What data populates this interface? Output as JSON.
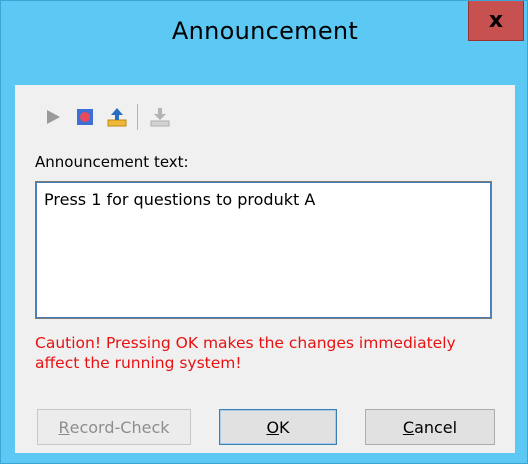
{
  "window": {
    "title": "Announcement",
    "close_glyph": "x"
  },
  "toolbar": {
    "buttons": [
      {
        "icon": "play-icon",
        "enabled": false
      },
      {
        "icon": "record-icon",
        "enabled": true
      },
      {
        "icon": "upload-icon",
        "enabled": true
      },
      {
        "icon": "download-icon",
        "enabled": false
      }
    ]
  },
  "form": {
    "label": "Announcement text:",
    "text_value": "Press 1 for questions to produkt A",
    "caution": "Caution! Pressing OK makes the changes immediately affect the running system!"
  },
  "buttons": {
    "record_check": {
      "mnemonic": "R",
      "rest": "ecord-Check",
      "enabled": false
    },
    "ok": {
      "mnemonic": "O",
      "rest": "K"
    },
    "cancel": {
      "mnemonic": "C",
      "rest": "ancel"
    }
  },
  "colors": {
    "titlebar": "#5cc9f5",
    "close_button": "#c75050",
    "caution_text": "#e81111",
    "dialog_bg": "#f0f0f0"
  }
}
